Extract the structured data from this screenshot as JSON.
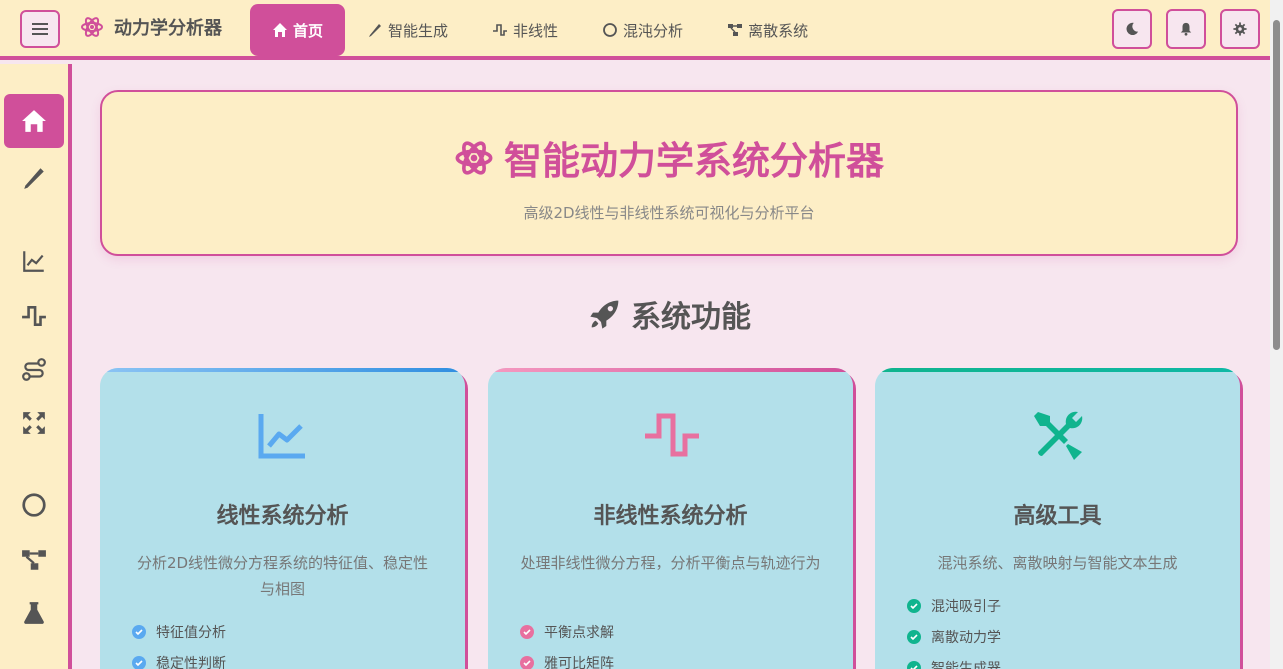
{
  "brand": {
    "name": "动力学分析器",
    "icon": "atom-icon"
  },
  "nav": [
    {
      "label": "首页",
      "icon": "home-icon",
      "active": true
    },
    {
      "label": "智能生成",
      "icon": "pencil-icon",
      "active": false
    },
    {
      "label": "非线性",
      "icon": "wave-icon",
      "active": false
    },
    {
      "label": "混沌分析",
      "icon": "circle-icon",
      "active": false
    },
    {
      "label": "离散系统",
      "icon": "network-icon",
      "active": false
    }
  ],
  "top_actions": [
    "moon-icon",
    "bell-icon",
    "gear-icon"
  ],
  "sidebar": [
    "home-icon",
    "pencil-icon",
    "chart-line-icon",
    "wave-icon",
    "route-icon",
    "expand-icon",
    "circle-icon",
    "network-icon",
    "flask-icon"
  ],
  "hero": {
    "title": "智能动力学系统分析器",
    "subtitle": "高级2D线性与非线性系统可视化与分析平台"
  },
  "section": {
    "title": "系统功能",
    "icon": "rocket-icon"
  },
  "cards": [
    {
      "title": "线性系统分析",
      "desc": "分析2D线性微分方程系统的特征值、稳定性与相图",
      "features": [
        "特征值分析",
        "稳定性判断"
      ],
      "accent": "#5aa9f0",
      "icon": "chart-line-icon"
    },
    {
      "title": "非线性系统分析",
      "desc": "处理非线性微分方程，分析平衡点与轨迹行为",
      "features": [
        "平衡点求解",
        "雅可比矩阵"
      ],
      "accent": "#e8709f",
      "icon": "wave-icon"
    },
    {
      "title": "高级工具",
      "desc": "混沌系统、离散映射与智能文本生成",
      "features": [
        "混沌吸引子",
        "离散动力学",
        "智能生成器"
      ],
      "accent": "#10b48e",
      "icon": "tools-icon"
    }
  ],
  "colors": {
    "primary": "#d04f9a",
    "bg": "#f7e6ef",
    "panel": "#fdeec6",
    "card": "#b3e0ea"
  }
}
